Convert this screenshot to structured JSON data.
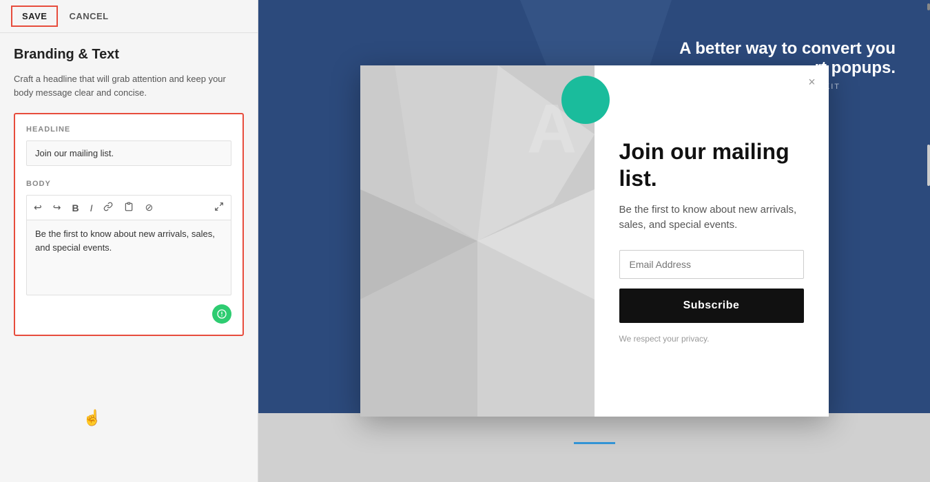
{
  "toolbar": {
    "save_label": "SAVE",
    "cancel_label": "CANCEL"
  },
  "left_panel": {
    "section_title": "Branding & Text",
    "section_description": "Craft a headline that will grab attention and keep your body message clear and concise.",
    "headline_label": "HEADLINE",
    "headline_value": "Join our mailing list.",
    "body_label": "BODY",
    "body_value": "Be the first to know about new arrivals, sales, and special events.",
    "body_placeholder": "Be the first to know about new arrivals, sales, and special events."
  },
  "popup": {
    "headline": "Join our mailing list.",
    "body": "Be the first to know about new arrivals, sales, and special events.",
    "email_placeholder": "Email Address",
    "subscribe_label": "Subscribe",
    "privacy_text": "We respect your privacy.",
    "close_icon": "×"
  },
  "toolbar_icons": {
    "undo": "↩",
    "redo": "↪",
    "bold": "B",
    "italic": "I",
    "link": "🔗",
    "clipboard": "📋",
    "block": "⊘",
    "expand": "⤢"
  },
  "website_bg": {
    "header_text": "A better way to convert you",
    "subheader": "rt popups.",
    "toolkit_label": "ON TOOLKIT",
    "big_letter": "A"
  }
}
